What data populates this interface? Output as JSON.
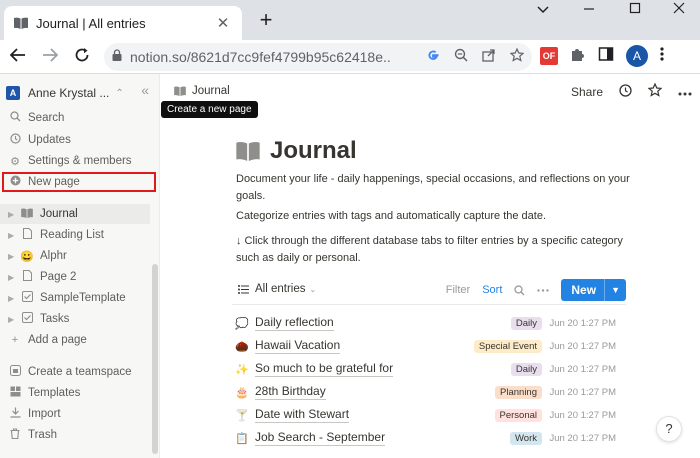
{
  "browser": {
    "tab_title": "Journal | All entries",
    "tab_close": "✕",
    "new_tab": "+",
    "url": "notion.so/8621d7cc9fef4799b95c62418e...",
    "ext_badge": "OF",
    "profile_initial": "A"
  },
  "sidebar": {
    "workspace_initial": "A",
    "workspace_name": "Anne Krystal ...",
    "menu": [
      {
        "label": "Search",
        "icon": "search-icon"
      },
      {
        "label": "Updates",
        "icon": "clock-icon"
      },
      {
        "label": "Settings & members",
        "icon": "gear-icon"
      },
      {
        "label": "New page",
        "icon": "plus-circle-icon"
      }
    ],
    "tooltip": "Create a new page",
    "pages": [
      {
        "label": "Journal",
        "icon": "book-icon"
      },
      {
        "label": "Reading List",
        "icon": "page-icon"
      },
      {
        "label": "Alphr",
        "icon": "smile-emoji"
      },
      {
        "label": "Page 2",
        "icon": "page-icon"
      },
      {
        "label": "SampleTemplate",
        "icon": "checkbox-icon"
      },
      {
        "label": "Tasks",
        "icon": "checkbox-icon"
      }
    ],
    "add_page": "Add a page",
    "bottom": [
      {
        "label": "Create a teamspace",
        "icon": "teamspace-icon"
      },
      {
        "label": "Templates",
        "icon": "templates-icon"
      },
      {
        "label": "Import",
        "icon": "import-icon"
      },
      {
        "label": "Trash",
        "icon": "trash-icon"
      }
    ]
  },
  "topbar": {
    "breadcrumb": "Journal",
    "share": "Share"
  },
  "page": {
    "title": "Journal",
    "description_1": "Document your life - daily happenings, special occasions, and reflections on your goals.",
    "description_2": "Categorize entries with tags and automatically capture the date.",
    "description_3": "↓ Click through the different database tabs to filter entries by a specific category such as daily or personal."
  },
  "database": {
    "view_label": "All entries",
    "filter_label": "Filter",
    "sort_label": "Sort",
    "new_label": "New",
    "entries": [
      {
        "emoji": "💭",
        "title": "Daily reflection",
        "tag": "Daily",
        "tag_color": "#e8deee",
        "date": "Jun 20 1:27 PM"
      },
      {
        "emoji": "🌰",
        "title": "Hawaii Vacation",
        "tag": "Special Event",
        "tag_color": "#fdecc8",
        "date": "Jun 20 1:27 PM"
      },
      {
        "emoji": "✨",
        "title": "So much to be grateful for",
        "tag": "Daily",
        "tag_color": "#e8deee",
        "date": "Jun 20 1:27 PM"
      },
      {
        "emoji": "🎂",
        "title": "28th Birthday",
        "tag": "Planning",
        "tag_color": "#fadec9",
        "date": "Jun 20 1:27 PM"
      },
      {
        "emoji": "🍸",
        "title": "Date with Stewart",
        "tag": "Personal",
        "tag_color": "#ffe2dd",
        "date": "Jun 20 1:27 PM"
      },
      {
        "emoji": "📋",
        "title": "Job Search - September",
        "tag": "Work",
        "tag_color": "#d3e5ef",
        "date": "Jun 20 1:27 PM"
      }
    ]
  },
  "help_label": "?"
}
